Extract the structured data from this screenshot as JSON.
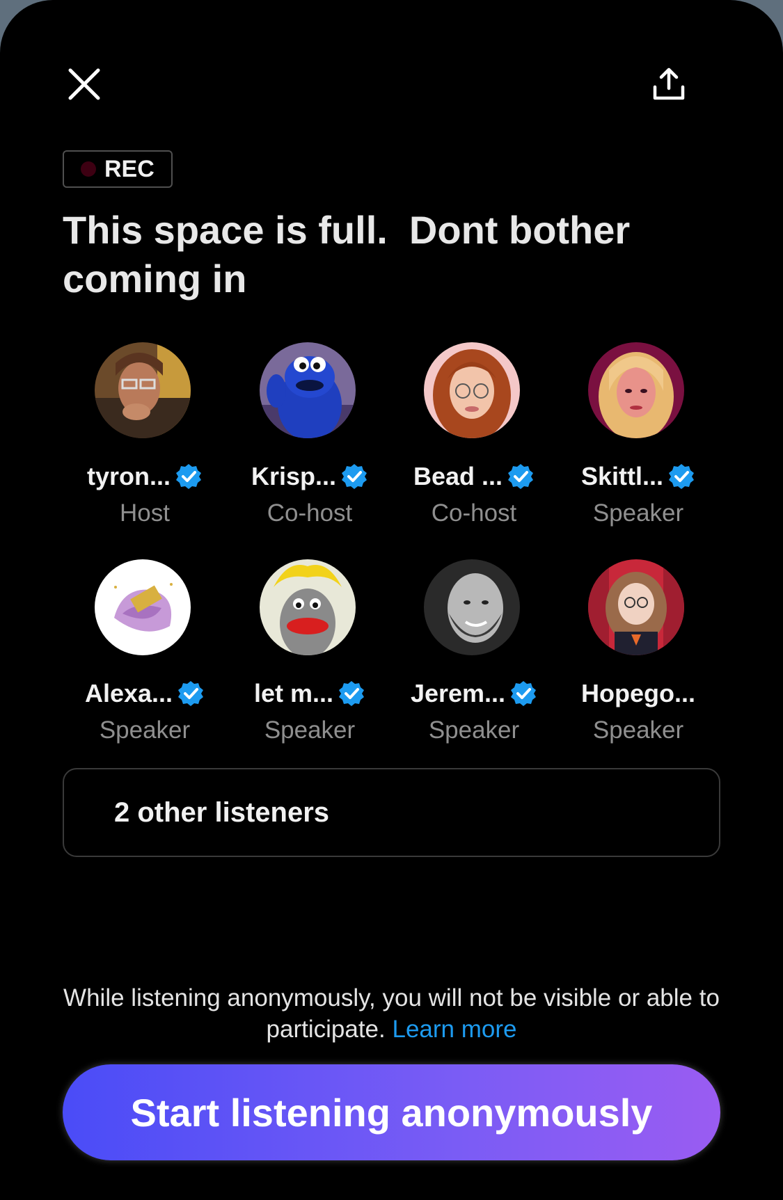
{
  "header": {
    "close_icon": "close-icon",
    "share_icon": "share-upload-icon"
  },
  "rec_badge": {
    "label": "REC",
    "dot_color": "#3d0012"
  },
  "space": {
    "title": "This space is full.  Dont bother coming in"
  },
  "participants": [
    {
      "name": "tyron...",
      "role": "Host",
      "verified": true
    },
    {
      "name": "Krisp...",
      "role": "Co-host",
      "verified": true
    },
    {
      "name": "Bead ...",
      "role": "Co-host",
      "verified": true
    },
    {
      "name": "Skittl...",
      "role": "Speaker",
      "verified": true
    },
    {
      "name": "Alexa...",
      "role": "Speaker",
      "verified": true
    },
    {
      "name": "let m...",
      "role": "Speaker",
      "verified": true
    },
    {
      "name": "Jerem...",
      "role": "Speaker",
      "verified": true
    },
    {
      "name": "Hopego...",
      "role": "Speaker",
      "verified": false
    }
  ],
  "listeners": {
    "label": "2 other listeners"
  },
  "notice": {
    "text": "While listening anonymously, you will not be visible or able to participate.",
    "link": "Learn more"
  },
  "cta": {
    "label": "Start listening anonymously"
  },
  "colors": {
    "accent": "#1d9bf0",
    "verified_badge": "#1d9bf0",
    "background": "#000000"
  }
}
